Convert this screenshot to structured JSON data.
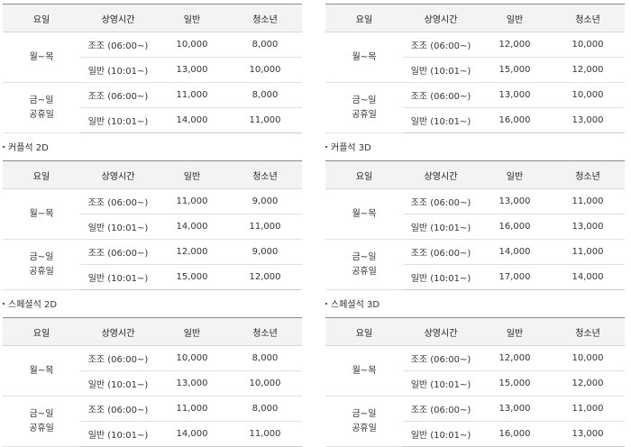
{
  "headers": [
    "요일",
    "상영시간",
    "일반",
    "청소년"
  ],
  "tables": [
    {
      "title": "",
      "rows": [
        {
          "day": [
            "월~목"
          ],
          "slots": [
            [
              "조조 (06:00~)",
              "10,000",
              "8,000"
            ],
            [
              "일반 (10:01~)",
              "13,000",
              "10,000"
            ]
          ]
        },
        {
          "day": [
            "금~일",
            "공휴일"
          ],
          "slots": [
            [
              "조조 (06:00~)",
              "11,000",
              "8,000"
            ],
            [
              "일반 (10:01~)",
              "14,000",
              "11,000"
            ]
          ]
        }
      ]
    },
    {
      "title": "",
      "rows": [
        {
          "day": [
            "월~목"
          ],
          "slots": [
            [
              "조조 (06:00~)",
              "12,000",
              "10,000"
            ],
            [
              "일반 (10:01~)",
              "15,000",
              "12,000"
            ]
          ]
        },
        {
          "day": [
            "금~일",
            "공휴일"
          ],
          "slots": [
            [
              "조조 (06:00~)",
              "13,000",
              "10,000"
            ],
            [
              "일반 (10:01~)",
              "16,000",
              "13,000"
            ]
          ]
        }
      ]
    },
    {
      "title": "커플석 2D",
      "rows": [
        {
          "day": [
            "월~목"
          ],
          "slots": [
            [
              "조조 (06:00~)",
              "11,000",
              "9,000"
            ],
            [
              "일반 (10:01~)",
              "14,000",
              "11,000"
            ]
          ]
        },
        {
          "day": [
            "금~일",
            "공휴일"
          ],
          "slots": [
            [
              "조조 (06:00~)",
              "12,000",
              "9,000"
            ],
            [
              "일반 (10:01~)",
              "15,000",
              "12,000"
            ]
          ]
        }
      ]
    },
    {
      "title": "커플석 3D",
      "rows": [
        {
          "day": [
            "월~목"
          ],
          "slots": [
            [
              "조조 (06:00~)",
              "13,000",
              "11,000"
            ],
            [
              "일반 (10:01~)",
              "16,000",
              "13,000"
            ]
          ]
        },
        {
          "day": [
            "금~일",
            "공휴일"
          ],
          "slots": [
            [
              "조조 (06:00~)",
              "14,000",
              "11,000"
            ],
            [
              "일반 (10:01~)",
              "17,000",
              "14,000"
            ]
          ]
        }
      ]
    },
    {
      "title": "스페셜석 2D",
      "rows": [
        {
          "day": [
            "월~목"
          ],
          "slots": [
            [
              "조조 (06:00~)",
              "10,000",
              "8,000"
            ],
            [
              "일반 (10:01~)",
              "13,000",
              "10,000"
            ]
          ]
        },
        {
          "day": [
            "금~일",
            "공휴일"
          ],
          "slots": [
            [
              "조조 (06:00~)",
              "11,000",
              "8,000"
            ],
            [
              "일반 (10:01~)",
              "14,000",
              "11,000"
            ]
          ]
        }
      ]
    },
    {
      "title": "스페셜석 3D",
      "rows": [
        {
          "day": [
            "월~목"
          ],
          "slots": [
            [
              "조조 (06:00~)",
              "12,000",
              "10,000"
            ],
            [
              "일반 (10:01~)",
              "15,000",
              "12,000"
            ]
          ]
        },
        {
          "day": [
            "금~일",
            "공휴일"
          ],
          "slots": [
            [
              "조조 (06:00~)",
              "13,000",
              "11,000"
            ],
            [
              "일반 (10:01~)",
              "16,000",
              "13,000"
            ]
          ]
        }
      ]
    }
  ]
}
